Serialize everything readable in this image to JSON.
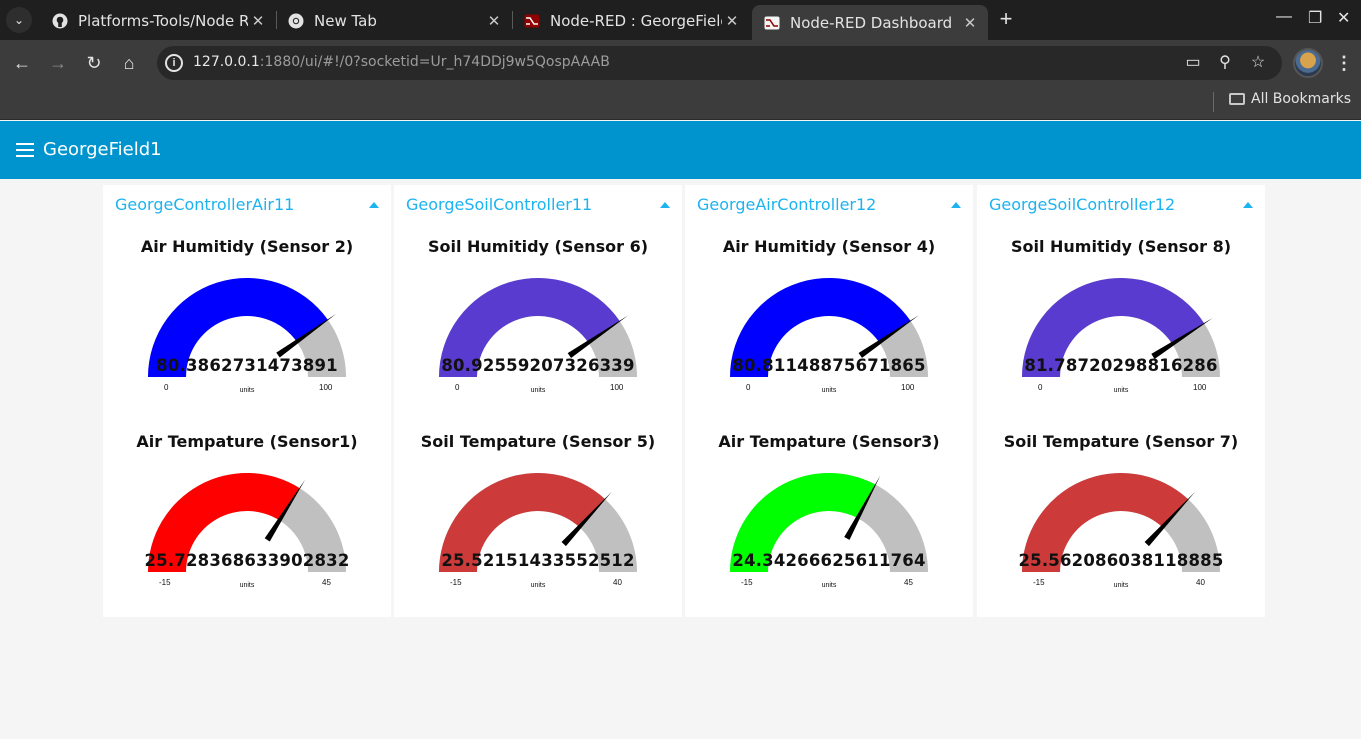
{
  "browser": {
    "tabs": [
      {
        "title": "Platforms-Tools/Node R",
        "icon": "github-icon",
        "active": false
      },
      {
        "title": "New Tab",
        "icon": "chrome-icon",
        "active": false
      },
      {
        "title": "Node-RED : GeorgeField",
        "icon": "nodered-icon",
        "active": false
      },
      {
        "title": "Node-RED Dashboard",
        "icon": "nodered-icon",
        "active": true
      }
    ],
    "url_host": "127.0.0.1",
    "url_rest": ":1880/ui/#!/0?socketid=Ur_h74DDj9w5QospAAAB",
    "bookmarks_label": "All Bookmarks"
  },
  "dashboard": {
    "title": "GeorgeField1",
    "header_color": "#0094ce",
    "accent_color": "#1bb3f0",
    "groups": [
      {
        "title": "GeorgeControllerAir11",
        "gauges": [
          {
            "label": "Air Humitidy (Sensor 2)",
            "value": "80.3862731473891",
            "min": "0",
            "max": "100",
            "units": "units",
            "color": "#0000ff"
          },
          {
            "label": "Air Tempature (Sensor1)",
            "value": "25.728368633902832",
            "min": "-15",
            "max": "45",
            "units": "units",
            "color": "#ff0000"
          }
        ]
      },
      {
        "title": "GeorgeSoilController11",
        "gauges": [
          {
            "label": "Soil Humitidy (Sensor 6)",
            "value": "80.92559207326339",
            "min": "0",
            "max": "100",
            "units": "units",
            "color": "#5a3bcf"
          },
          {
            "label": "Soil Tempature (Sensor 5)",
            "value": "25.52151433552512",
            "min": "-15",
            "max": "40",
            "units": "units",
            "color": "#cc3a3a"
          }
        ]
      },
      {
        "title": "GeorgeAirController12",
        "gauges": [
          {
            "label": "Air Humitidy (Sensor 4)",
            "value": "80.81148875671865",
            "min": "0",
            "max": "100",
            "units": "units",
            "color": "#0000ff"
          },
          {
            "label": "Air Tempature (Sensor3)",
            "value": "24.34266625611764",
            "min": "-15",
            "max": "45",
            "units": "units",
            "color": "#00ff00"
          }
        ]
      },
      {
        "title": "GeorgeSoilController12",
        "gauges": [
          {
            "label": "Soil Humitidy (Sensor 8)",
            "value": "81.78720298816286",
            "min": "0",
            "max": "100",
            "units": "units",
            "color": "#5a3bcf"
          },
          {
            "label": "Soil Tempature (Sensor 7)",
            "value": "25.562086038118885",
            "min": "-15",
            "max": "40",
            "units": "units",
            "color": "#cc3a3a"
          }
        ]
      }
    ]
  }
}
